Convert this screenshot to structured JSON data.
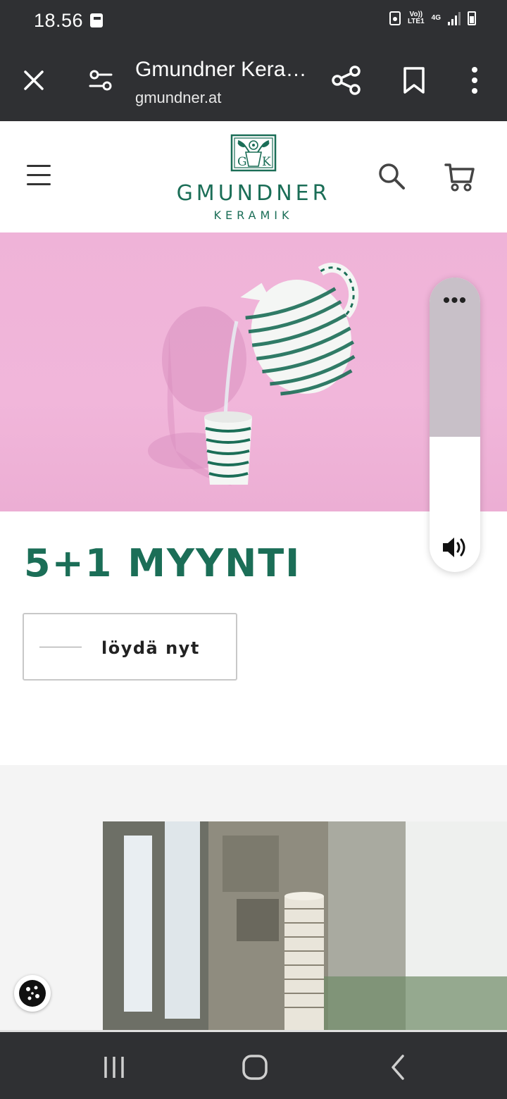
{
  "status_bar": {
    "time": "18.56",
    "network_volte": "Vo))\nLTE1",
    "network_type": "4G"
  },
  "browser": {
    "page_title": "Gmundner Kera…",
    "url": "gmundner.at"
  },
  "site": {
    "logo_emblem_letters": [
      "G",
      "K"
    ],
    "logo_name": "GMUNDNER",
    "logo_sub": "KERAMIK"
  },
  "promo": {
    "title": "5+1 MYYNTI",
    "button_label": "löydä nyt"
  },
  "volume_panel": {
    "menu_dots": "•••",
    "level": 0.46
  },
  "colors": {
    "brand_green": "#1b6e57",
    "hero_pink": "#f1b6da",
    "system_bar": "#2f3033"
  }
}
